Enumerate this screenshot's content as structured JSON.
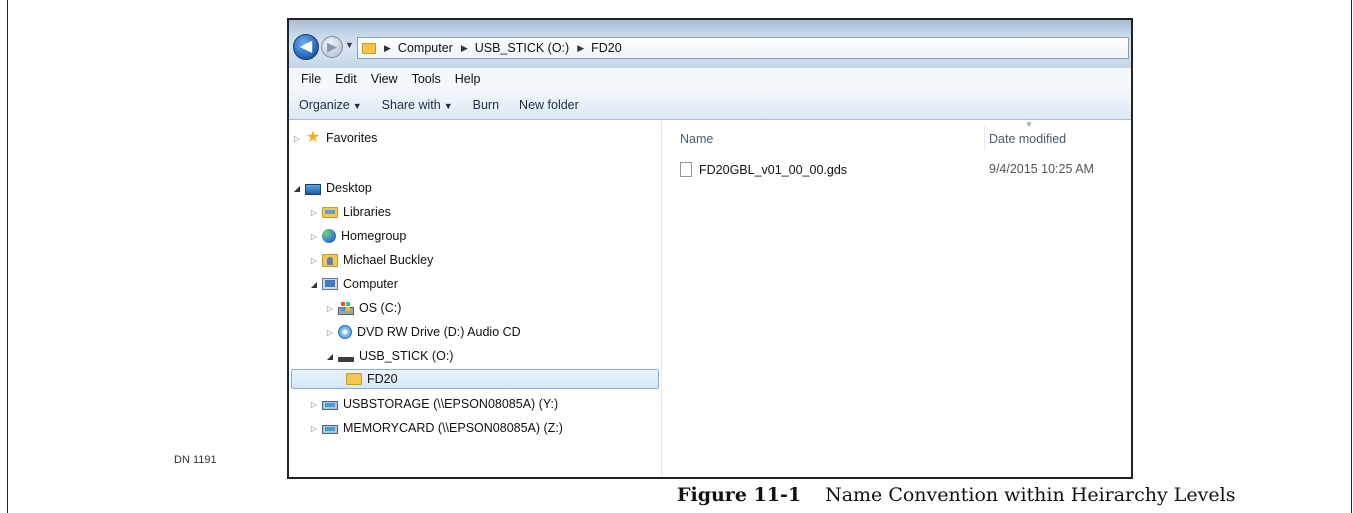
{
  "address_bar": {
    "crumbs": [
      "Computer",
      "USB_STICK (O:)",
      "FD20"
    ]
  },
  "menu": [
    "File",
    "Edit",
    "View",
    "Tools",
    "Help"
  ],
  "toolbar": {
    "organize": "Organize",
    "share_with": "Share with",
    "burn": "Burn",
    "new_folder": "New folder"
  },
  "nav_tree": {
    "favorites": "Favorites",
    "desktop": "Desktop",
    "libraries": "Libraries",
    "homegroup": "Homegroup",
    "user": "Michael Buckley",
    "computer": "Computer",
    "drive_c": "OS (C:)",
    "drive_d": "DVD RW Drive (D:) Audio CD",
    "drive_o": "USB_STICK (O:)",
    "folder_fd20": "FD20",
    "drive_y": "USBSTORAGE (\\\\EPSON08085A) (Y:)",
    "drive_z": "MEMORYCARD (\\\\EPSON08085A) (Z:)"
  },
  "file_list": {
    "col_name": "Name",
    "col_date": "Date modified",
    "files": [
      {
        "name": "FD20GBL_v01_00_00.gds",
        "date": "9/4/2015 10:25 AM"
      }
    ]
  },
  "document": {
    "note": "DN 1191",
    "figure_number": "Figure  11-1",
    "figure_title": "Name Convention within Heirarchy Levels"
  },
  "icons": {
    "back": "back-arrow-icon",
    "forward": "forward-arrow-icon",
    "star": "star-icon",
    "folder": "folder-icon",
    "file": "file-icon"
  }
}
